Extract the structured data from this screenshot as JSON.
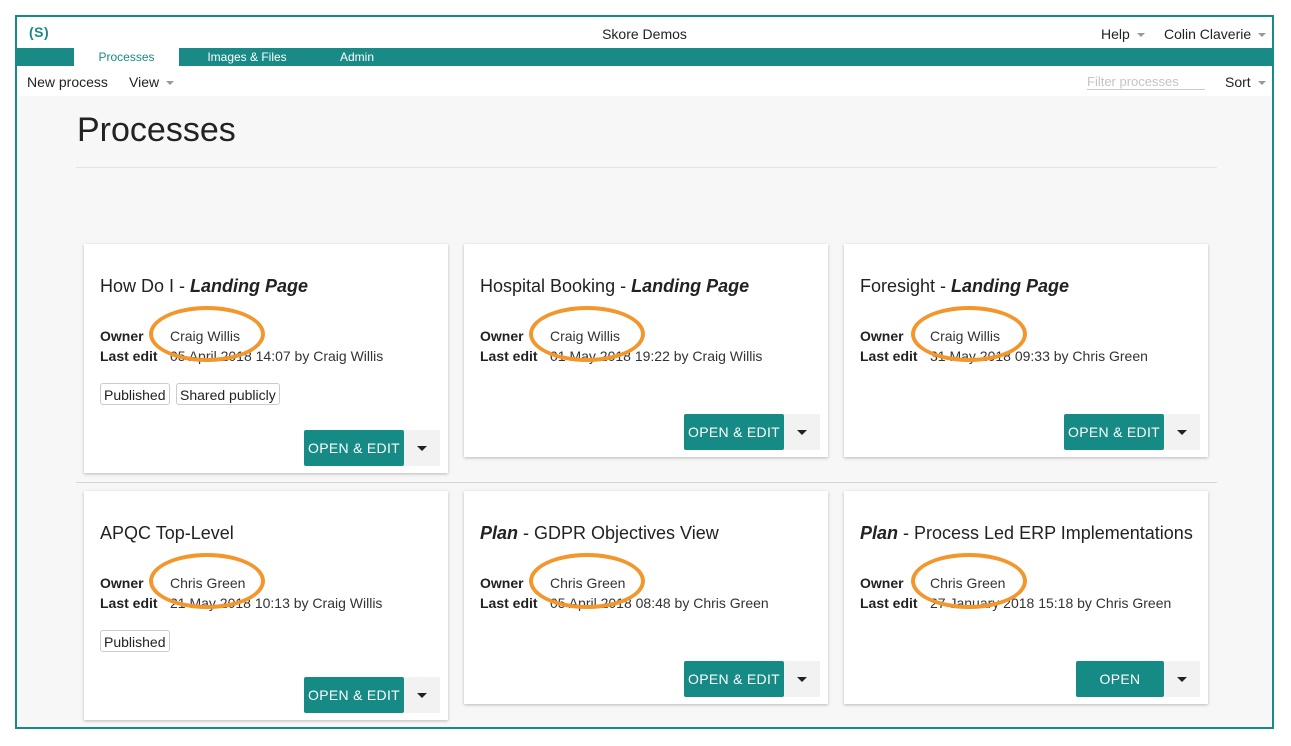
{
  "app": {
    "logo": "(S)",
    "title": "Skore Demos",
    "help": "Help",
    "user": "Colin Claverie"
  },
  "tabs": [
    "Processes",
    "Images & Files",
    "Admin"
  ],
  "toolbar": {
    "new_process": "New process",
    "view": "View",
    "filter_placeholder": "Filter processes",
    "sort": "Sort"
  },
  "page": {
    "title": "Processes"
  },
  "labels": {
    "owner": "Owner",
    "last_edit": "Last edit"
  },
  "accent": "#1a8a87",
  "highlight": "#f3962c",
  "cards": [
    {
      "title_plain": "How Do I - ",
      "title_bold": "Landing Page",
      "owner": "Craig Willis",
      "last_edit": "05 April 2018 14:07 by Craig Willis",
      "badges": [
        "Published",
        "Shared publicly"
      ],
      "action": "OPEN & EDIT"
    },
    {
      "title_plain": "Hospital Booking - ",
      "title_bold": "Landing Page",
      "owner": "Craig Willis",
      "last_edit": "01 May 2018 19:22 by Craig Willis",
      "badges": [],
      "action": "OPEN & EDIT"
    },
    {
      "title_plain": "Foresight - ",
      "title_bold": "Landing Page",
      "owner": "Craig Willis",
      "last_edit": "31 May 2018 09:33 by Chris Green",
      "badges": [],
      "action": "OPEN & EDIT"
    },
    {
      "title_bold": "",
      "title_plain": "APQC Top-Level",
      "owner": "Chris Green",
      "last_edit": "21 May 2018 10:13 by Craig Willis",
      "badges": [
        "Published"
      ],
      "action": "OPEN & EDIT"
    },
    {
      "title_bold": "Plan",
      "title_plain": " - GDPR Objectives View",
      "owner": "Chris Green",
      "last_edit": "05 April 2018 08:48 by Chris Green",
      "badges": [],
      "action": "OPEN & EDIT"
    },
    {
      "title_bold": "Plan",
      "title_plain": " - Process Led ERP Implementations",
      "owner": "Chris Green",
      "last_edit": "27 January 2018 15:18 by Chris Green",
      "badges": [],
      "action": "OPEN"
    }
  ]
}
